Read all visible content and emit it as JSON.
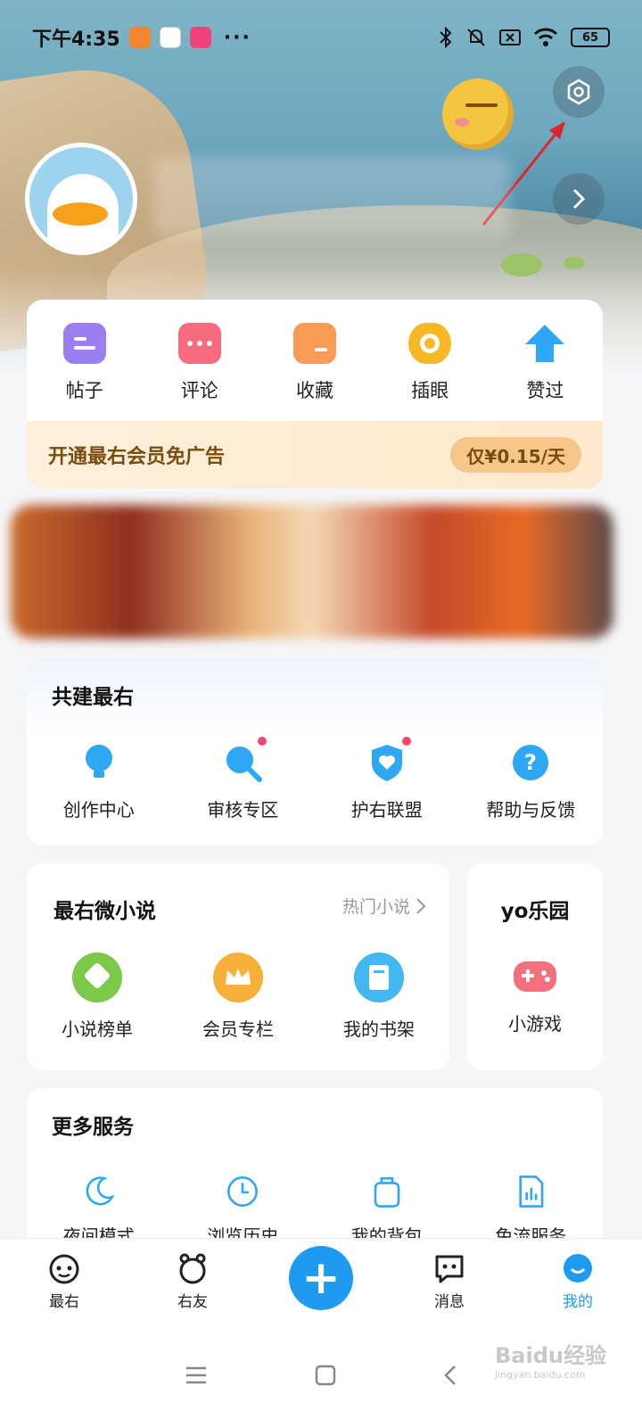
{
  "status_bar": {
    "time": "下午4:35",
    "dots": "···",
    "battery": "65"
  },
  "quick_actions": [
    {
      "label": "帖子",
      "color": "#9b7ff2"
    },
    {
      "label": "评论",
      "color": "#f66b7f"
    },
    {
      "label": "收藏",
      "color": "#fb9a57"
    },
    {
      "label": "插眼",
      "color": "#f7b826"
    },
    {
      "label": "赞过",
      "color": "#2ea7f5"
    }
  ],
  "vip": {
    "text": "开通最右会员免广告",
    "price": "仅¥0.15/天"
  },
  "cobuild": {
    "title": "共建最右",
    "items": [
      {
        "label": "创作中心",
        "icon": "lightbulb-icon"
      },
      {
        "label": "审核专区",
        "icon": "search-icon"
      },
      {
        "label": "护右联盟",
        "icon": "shield-heart-icon"
      },
      {
        "label": "帮助与反馈",
        "icon": "help-icon"
      }
    ]
  },
  "novel": {
    "title": "最右微小说",
    "more": "热门小说",
    "items": [
      {
        "label": "小说榜单",
        "color": "#7cc94a"
      },
      {
        "label": "会员专栏",
        "color": "#f7b13a"
      },
      {
        "label": "我的书架",
        "color": "#42b7f0"
      }
    ]
  },
  "yo": {
    "title": "yo乐园",
    "item": "小游戏"
  },
  "more_services": {
    "title": "更多服务",
    "items": [
      {
        "label": "夜间模式",
        "icon": "moon-icon"
      },
      {
        "label": "浏览历史",
        "icon": "clock-icon"
      },
      {
        "label": "我的背包",
        "icon": "backpack-icon"
      },
      {
        "label": "免流服务",
        "icon": "data-icon"
      }
    ]
  },
  "tabbar": {
    "tabs": [
      {
        "label": "最右"
      },
      {
        "label": "右友"
      },
      {
        "label": "消息"
      },
      {
        "label": "我的"
      }
    ],
    "fab": "+"
  },
  "watermark": {
    "text": "Baidu经验",
    "sub": "jingyan.baidu.com"
  },
  "colors": {
    "accent": "#1e9bf0",
    "annotation": "#d9262b"
  }
}
